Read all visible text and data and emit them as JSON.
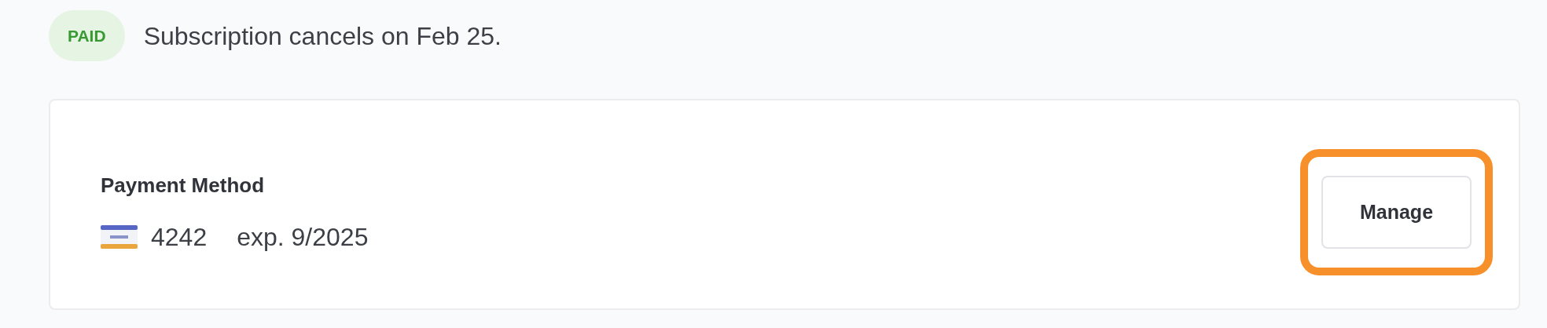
{
  "status": {
    "badge": "PAID",
    "message": "Subscription cancels on Feb 25."
  },
  "payment_method": {
    "title": "Payment Method",
    "card_last4": "4242",
    "expiry": "exp. 9/2025",
    "action": "Manage",
    "highlighted": true
  }
}
